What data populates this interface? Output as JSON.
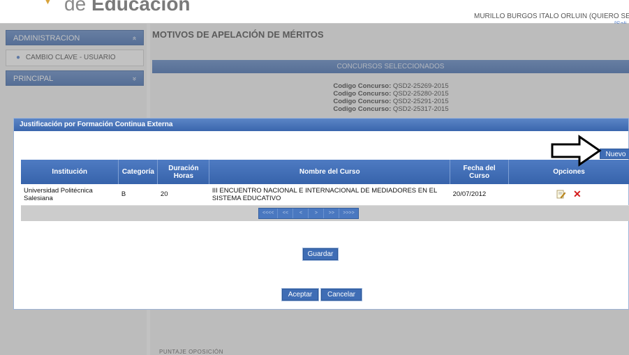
{
  "header": {
    "logo_prefix": "de",
    "logo_word": "Educación",
    "user_name": "MURILLO BURGOS ITALO ORLUIN (QUIERO SER",
    "user_link": "[Sali"
  },
  "sidebar": {
    "admin_label": "ADMINISTRACION",
    "admin_chevron": "«",
    "item_label": "CAMBIO CLAVE - USUARIO",
    "principal_label": "PRINCIPAL",
    "principal_chevron": "»"
  },
  "main": {
    "title": "MOTIVOS DE APELACIÓN DE MÉRITOS",
    "concursos_header": "CONCURSOS SELECCIONADOS",
    "concursos_label": "Codigo Concurso:",
    "concursos": [
      "QSD2-25269-2015",
      "QSD2-25280-2015",
      "QSD2-25291-2015",
      "QSD2-25317-2015"
    ],
    "footer_text": "PUNTAJE OPOSICIÓN"
  },
  "modal": {
    "title": "Justificación por Formación Continua Externa",
    "new_button": "Nuevo",
    "columns": {
      "institucion": "Institución",
      "categoria": "Categoría",
      "duracion_1": "Duración",
      "duracion_2": "Horas",
      "nombre": "Nombre del Curso",
      "fecha_1": "Fecha del",
      "fecha_2": "Curso",
      "opciones": "Opciones"
    },
    "row": {
      "institucion_1": "Universidad Politécnica",
      "institucion_2": "Salesiana",
      "categoria": "B",
      "duracion": "20",
      "nombre_1": "III ENCUENTRO NACIONAL E INTERNACIONAL DE MEDIADORES EN EL",
      "nombre_2": "SISTEMA EDUCATIVO",
      "fecha": "20/07/2012",
      "edit_icon": "edit-icon",
      "delete_icon": "delete-icon"
    },
    "pager": [
      "<<<<",
      "<<",
      "<",
      ">",
      ">>",
      ">>>>"
    ],
    "save_button": "Guardar",
    "accept_button": "Aceptar",
    "cancel_button": "Cancelar"
  },
  "colors": {
    "accent": "#3f6db5",
    "header_blue": "#4e7bc2",
    "delete_red": "#d41a1a"
  }
}
